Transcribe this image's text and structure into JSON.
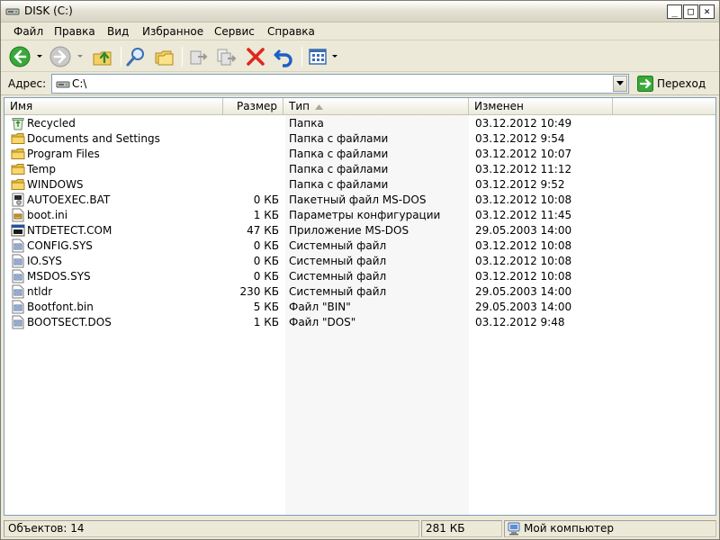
{
  "window": {
    "title": "DISK (C:)",
    "min_glyph": "_",
    "max_glyph": "□",
    "close_glyph": "✕"
  },
  "menu": [
    {
      "label": "Файл"
    },
    {
      "label": "Правка"
    },
    {
      "label": "Вид"
    },
    {
      "label": "Избранное"
    },
    {
      "label": "Сервис"
    },
    {
      "label": "Справка"
    }
  ],
  "toolbar": {
    "icons": [
      "back-icon",
      "forward-icon",
      "up-folder-icon",
      "search-icon",
      "folders-icon",
      "move-to-icon",
      "copy-to-icon",
      "delete-icon",
      "undo-icon",
      "views-icon"
    ]
  },
  "address": {
    "label": "Адрес:",
    "value": "C:\\",
    "go_label": "Переход"
  },
  "columns": {
    "name": "Имя",
    "size": "Размер",
    "type": "Тип",
    "modified": "Изменен"
  },
  "files": [
    {
      "name": "Recycled",
      "size": "",
      "type": "Папка",
      "modified": "03.12.2012 10:49",
      "icon": "recycle-bin-icon"
    },
    {
      "name": "Documents and Settings",
      "size": "",
      "type": "Папка с файлами",
      "modified": "03.12.2012 9:54",
      "icon": "folder-icon"
    },
    {
      "name": "Program Files",
      "size": "",
      "type": "Папка с файлами",
      "modified": "03.12.2012 10:07",
      "icon": "folder-icon"
    },
    {
      "name": "Temp",
      "size": "",
      "type": "Папка с файлами",
      "modified": "03.12.2012 11:12",
      "icon": "folder-icon"
    },
    {
      "name": "WINDOWS",
      "size": "",
      "type": "Папка с файлами",
      "modified": "03.12.2012 9:52",
      "icon": "folder-icon"
    },
    {
      "name": "AUTOEXEC.BAT",
      "size": "0 КБ",
      "type": "Пакетный файл MS-DOS",
      "modified": "03.12.2012 10:08",
      "icon": "batch-file-icon"
    },
    {
      "name": "boot.ini",
      "size": "1 КБ",
      "type": "Параметры конфигурации",
      "modified": "03.12.2012 11:45",
      "icon": "config-file-icon"
    },
    {
      "name": "NTDETECT.COM",
      "size": "47 КБ",
      "type": "Приложение MS-DOS",
      "modified": "29.05.2003 14:00",
      "icon": "dos-app-icon"
    },
    {
      "name": "CONFIG.SYS",
      "size": "0 КБ",
      "type": "Системный файл",
      "modified": "03.12.2012 10:08",
      "icon": "system-file-icon"
    },
    {
      "name": "IO.SYS",
      "size": "0 КБ",
      "type": "Системный файл",
      "modified": "03.12.2012 10:08",
      "icon": "system-file-icon"
    },
    {
      "name": "MSDOS.SYS",
      "size": "0 КБ",
      "type": "Системный файл",
      "modified": "03.12.2012 10:08",
      "icon": "system-file-icon"
    },
    {
      "name": "ntldr",
      "size": "230 КБ",
      "type": "Системный файл",
      "modified": "29.05.2003 14:00",
      "icon": "system-file-icon"
    },
    {
      "name": "Bootfont.bin",
      "size": "5 КБ",
      "type": "Файл \"BIN\"",
      "modified": "29.05.2003 14:00",
      "icon": "generic-file-icon"
    },
    {
      "name": "BOOTSECT.DOS",
      "size": "1 КБ",
      "type": "Файл \"DOS\"",
      "modified": "03.12.2012 9:48",
      "icon": "system-file-icon"
    }
  ],
  "status": {
    "objects": "Объектов: 14",
    "size": "281 КБ",
    "location": "Мой компьютер"
  },
  "colors": {
    "window_bg": "#ece9d8",
    "sorted_column_bg": "#f7f7f7",
    "list_border": "#7f9db9"
  }
}
